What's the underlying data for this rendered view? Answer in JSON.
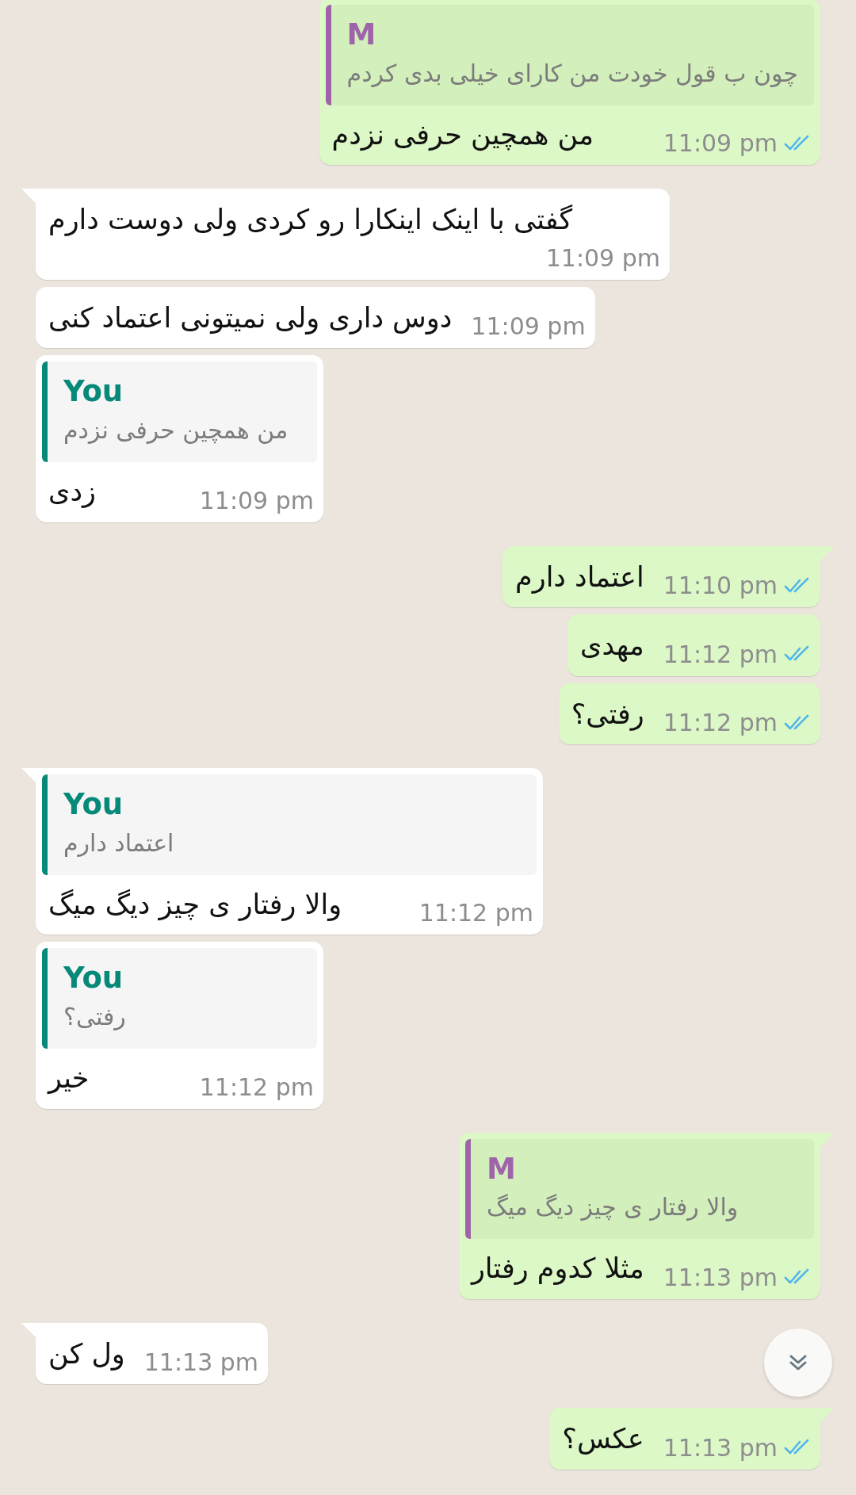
{
  "messages": [
    {
      "kind": "out",
      "tail": false,
      "quote": {
        "author": "M",
        "color": "#9e63a8",
        "text": "چون ب قول خودت من کارای خیلی بدی کردم"
      },
      "text": "من همچین حرفی نزدم",
      "time": "11:09 pm",
      "read": true
    },
    {
      "kind": "in",
      "tail": true,
      "text": "گفتی با اینک اینکارا رو کردی ولی دوست دارم",
      "time": "11:09 pm"
    },
    {
      "kind": "in",
      "tail": false,
      "text": "دوس داری ولی  نمیتونی اعتماد کنی",
      "time": "11:09 pm"
    },
    {
      "kind": "in",
      "tail": false,
      "quote": {
        "author": "You",
        "color": "#07897a",
        "text": "من همچین حرفی نزدم"
      },
      "text": "زدی",
      "time": "11:09 pm"
    },
    {
      "kind": "out",
      "tail": true,
      "text": "اعتماد دارم",
      "time": "11:10 pm",
      "read": true
    },
    {
      "kind": "out",
      "tail": false,
      "text": "مهدی",
      "time": "11:12 pm",
      "read": true
    },
    {
      "kind": "out",
      "tail": false,
      "text": "رفتی؟",
      "time": "11:12 pm",
      "read": true
    },
    {
      "kind": "in",
      "tail": true,
      "quote": {
        "author": "You",
        "color": "#07897a",
        "text": "اعتماد دارم"
      },
      "text": "والا رفتار ی چیز دیگ میگ",
      "time": "11:12 pm"
    },
    {
      "kind": "in",
      "tail": false,
      "quote": {
        "author": "You",
        "color": "#07897a",
        "text": "رفتی؟"
      },
      "text": "خیر",
      "time": "11:12 pm"
    },
    {
      "kind": "out",
      "tail": true,
      "quote": {
        "author": "M",
        "color": "#9e63a8",
        "text": "والا رفتار ی چیز دیگ میگ"
      },
      "text": "مثلا کدوم رفتار",
      "time": "11:13 pm",
      "read": true
    },
    {
      "kind": "in",
      "tail": true,
      "text": "ول کن",
      "time": "11:13 pm"
    },
    {
      "kind": "out",
      "tail": true,
      "text": "عکس؟",
      "time": "11:13 pm",
      "read": true
    }
  ]
}
